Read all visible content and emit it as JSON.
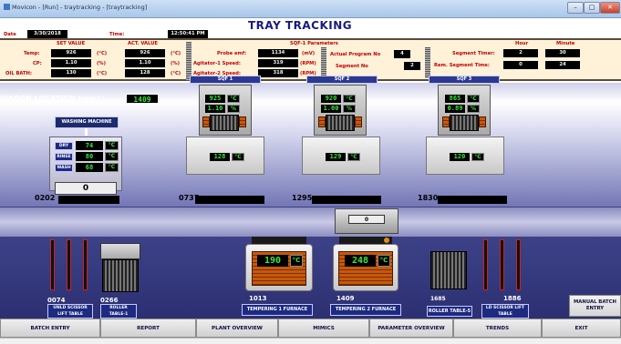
{
  "window": {
    "title": "Movicon - [Run] - traytracking - [traytracking]",
    "min": "–",
    "max": "□",
    "close": "✕"
  },
  "page_title": "TRAY TRACKING",
  "header": {
    "date_label": "Date",
    "date": "3/30/2018",
    "time_label": "Time:",
    "time": "12:50:41 PM"
  },
  "setpoints": {
    "set_header": "SET VALUE",
    "act_header": "ACT. VALUE",
    "rows": [
      {
        "label": "Temp:",
        "set": "926",
        "act": "926",
        "unit": "(°C)"
      },
      {
        "label": "CP:",
        "set": "1.10",
        "act": "1.10",
        "unit": "(%)"
      },
      {
        "label": "OIL BATH:",
        "set": "130",
        "act": "128",
        "unit": "(°C)"
      }
    ]
  },
  "sqf1": {
    "header": "SQF-1 Parameters",
    "rows": [
      {
        "label": "Probe emf:",
        "value": "1134",
        "unit": "(mV)"
      },
      {
        "label": "Agitator-1 Speed:",
        "value": "319",
        "unit": "(RPM)"
      },
      {
        "label": "Agitator-2 Speed:",
        "value": "318",
        "unit": "(RPM)"
      }
    ],
    "actual_program_label": "Actual Program No",
    "actual_program": "4",
    "segment_no_label": "Segment No",
    "segment_no": "2"
  },
  "segment": {
    "hour_header": "Hour",
    "minute_header": "Minute",
    "rows": [
      {
        "label": "Segment Timer:",
        "hour": "2",
        "minute": "30"
      },
      {
        "label": "Rem. Segment Time:",
        "hour": "0",
        "minute": "24"
      }
    ]
  },
  "wagon": {
    "label": "WAGON LOCATION (mm) :",
    "value": "1409"
  },
  "washing_machine": {
    "label": "WASHING MACHINE",
    "rows": [
      {
        "label": "DRY",
        "value": "74",
        "unit": "°C"
      },
      {
        "label": "RINSE",
        "value": "80",
        "unit": "°C"
      },
      {
        "label": "WASH",
        "value": "68",
        "unit": "°C"
      }
    ],
    "counter": "0",
    "position": "0202"
  },
  "furnaces": [
    {
      "label": "SQF 1",
      "temp": "925",
      "temp_unit": "°C",
      "cp": "1.10",
      "cp_unit": "%",
      "bottom": "128",
      "bottom_unit": "°C",
      "position": "0737"
    },
    {
      "label": "SQF 2",
      "temp": "920",
      "temp_unit": "°C",
      "cp": "1.00",
      "cp_unit": "%",
      "bottom": "129",
      "bottom_unit": "°C",
      "position": "1295"
    },
    {
      "label": "SQF 3",
      "temp": "865",
      "temp_unit": "°C",
      "cp": "0.89",
      "cp_unit": "%",
      "bottom": "120",
      "bottom_unit": "°C",
      "position": "1830"
    }
  ],
  "transfer_car": {
    "value": "0"
  },
  "lower": {
    "unld_scissor": {
      "label": "UNLD SCISSOR LIFT TABLE",
      "position": "0074"
    },
    "roller_table_1": {
      "label": "ROLLER TABLE-1",
      "position": "0266"
    },
    "tempering_1": {
      "label": "TEMPERING 1 FURNACE",
      "temp": "190",
      "unit": "°C",
      "position": "1013"
    },
    "tempering_2": {
      "label": "TEMPERING 2 FURNACE",
      "temp": "248",
      "unit": "°C",
      "position": "1409"
    },
    "roller_table_5": {
      "label": "ROLLER TABLE-5",
      "position": "1685"
    },
    "ld_scissor": {
      "label": "LD SCISSOR LIFT TABLE",
      "position": "1886"
    },
    "manual_batch": "MANUAL BATCH ENTRY"
  },
  "nav": [
    "BATCH ENTRY",
    "REPORT",
    "PLANT OVERVIEW",
    "MIMICS",
    "PARAMETER OVERVIEW",
    "TRENDS",
    "EXIT"
  ]
}
